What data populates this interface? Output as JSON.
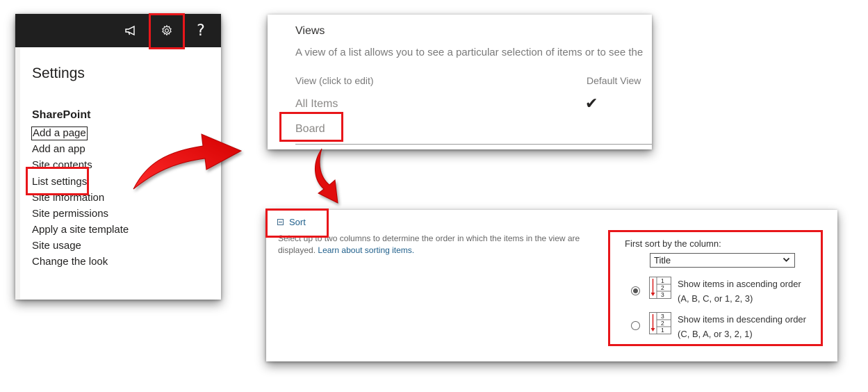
{
  "settings_panel": {
    "icons": {
      "megaphone": "megaphone-icon",
      "gear": "gear-icon",
      "help": "help-icon"
    },
    "help_label": "?",
    "title": "Settings",
    "section_heading": "SharePoint",
    "items": [
      "Add a page",
      "Add an app",
      "Site contents",
      "List settings",
      "Site information",
      "Site permissions",
      "Apply a site template",
      "Site usage",
      "Change the look"
    ]
  },
  "views_panel": {
    "title": "Views",
    "description": "A view of a list allows you to see a particular selection of items or to see the",
    "col_view": "View (click to edit)",
    "col_default": "Default View",
    "rows": [
      "All Items",
      "Board"
    ],
    "default_mark": "✔"
  },
  "sort_panel": {
    "link_label": "Sort",
    "description": "Select up to two columns to determine the order in which the items in the view are displayed.",
    "learn_link": "Learn about sorting items.",
    "first_sort_label": "First sort by the column:",
    "selected_column": "Title",
    "options": [
      {
        "line1": "Show items in ascending order",
        "line2": "(A, B, C, or 1, 2, 3)",
        "selected": true
      },
      {
        "line1": "Show items in descending order",
        "line2": "(C, B, A, or 3, 2, 1)",
        "selected": false
      }
    ],
    "ascending_digits": [
      "1",
      "2",
      "3"
    ],
    "descending_digits": [
      "3",
      "2",
      "1"
    ]
  },
  "colors": {
    "highlight": "#e8161a",
    "topbar": "#1f1f1f",
    "link": "#1f5f8b"
  }
}
